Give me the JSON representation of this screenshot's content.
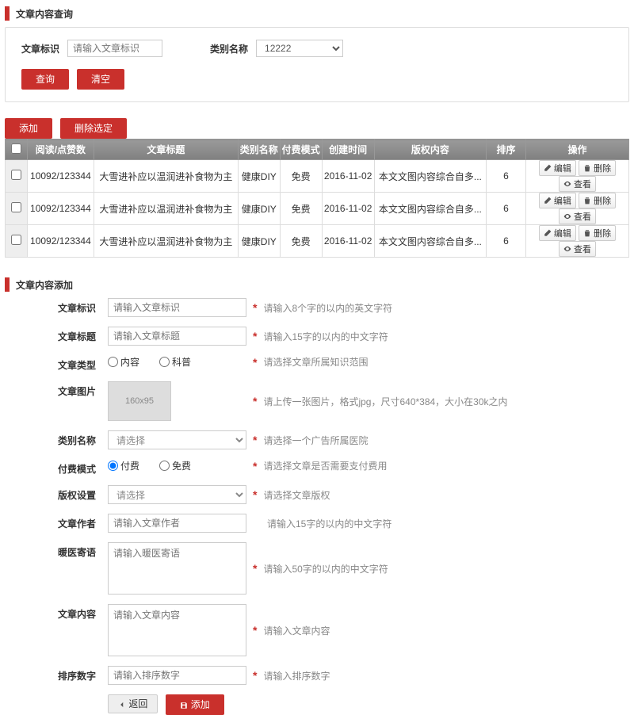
{
  "searchSection": {
    "title": "文章内容查询",
    "fields": {
      "articleId": {
        "label": "文章标识",
        "placeholder": "请输入文章标识"
      },
      "category": {
        "label": "类别名称",
        "value": "12222"
      }
    },
    "buttons": {
      "query": "查询",
      "clear": "清空"
    }
  },
  "toolbar": {
    "add": "添加",
    "deleteSelected": "删除选定"
  },
  "table": {
    "headers": {
      "reads": "阅读/点赞数",
      "title": "文章标题",
      "category": "类别名称",
      "payMode": "付费模式",
      "createTime": "创建时间",
      "copyright": "版权内容",
      "sort": "排序",
      "ops": "操作"
    },
    "rows": [
      {
        "reads": "10092/123344",
        "title": "大雪进补应以温润进补食物为主",
        "category": "健康DIY",
        "payMode": "免费",
        "createTime": "2016-11-02",
        "copyright": "本文文图内容综合自多...",
        "sort": "6"
      },
      {
        "reads": "10092/123344",
        "title": "大雪进补应以温润进补食物为主",
        "category": "健康DIY",
        "payMode": "免费",
        "createTime": "2016-11-02",
        "copyright": "本文文图内容综合自多...",
        "sort": "6"
      },
      {
        "reads": "10092/123344",
        "title": "大雪进补应以温润进补食物为主",
        "category": "健康DIY",
        "payMode": "免费",
        "createTime": "2016-11-02",
        "copyright": "本文文图内容综合自多...",
        "sort": "6"
      }
    ],
    "ops": {
      "edit": "编辑",
      "delete": "删除",
      "view": "查看"
    }
  },
  "addSection": {
    "title": "文章内容添加",
    "fields": {
      "articleId": {
        "label": "文章标识",
        "placeholder": "请输入文章标识",
        "hint": "请输入8个字的以内的英文字符"
      },
      "articleTitle": {
        "label": "文章标题",
        "placeholder": "请输入文章标题",
        "hint": "请输入15字的以内的中文字符"
      },
      "articleType": {
        "label": "文章类型",
        "opt1": "内容",
        "opt2": "科普",
        "hint": "请选择文章所属知识范围"
      },
      "articleImage": {
        "label": "文章图片",
        "placeholder": "160x95",
        "hint": "请上传一张图片，格式jpg，尺寸640*384，大小在30k之内"
      },
      "category": {
        "label": "类别名称",
        "placeholder": "请选择",
        "hint": "请选择一个广告所属医院"
      },
      "payMode": {
        "label": "付费模式",
        "opt1": "付费",
        "opt2": "免费",
        "hint": "请选择文章是否需要支付费用"
      },
      "copyright": {
        "label": "版权设置",
        "placeholder": "请选择",
        "hint": "请选择文章版权"
      },
      "author": {
        "label": "文章作者",
        "placeholder": "请输入文章作者",
        "hint": "请输入15字的以内的中文字符"
      },
      "whisper": {
        "label": "暖医寄语",
        "placeholder": "请输入暖医寄语",
        "hint": "请输入50字的以内的中文字符"
      },
      "content": {
        "label": "文章内容",
        "placeholder": "请输入文章内容",
        "hint": "请输入文章内容"
      },
      "sortNum": {
        "label": "排序数字",
        "placeholder": "请输入排序数字",
        "hint": "请输入排序数字"
      }
    },
    "buttons": {
      "back": "返回",
      "add": "添加"
    }
  }
}
